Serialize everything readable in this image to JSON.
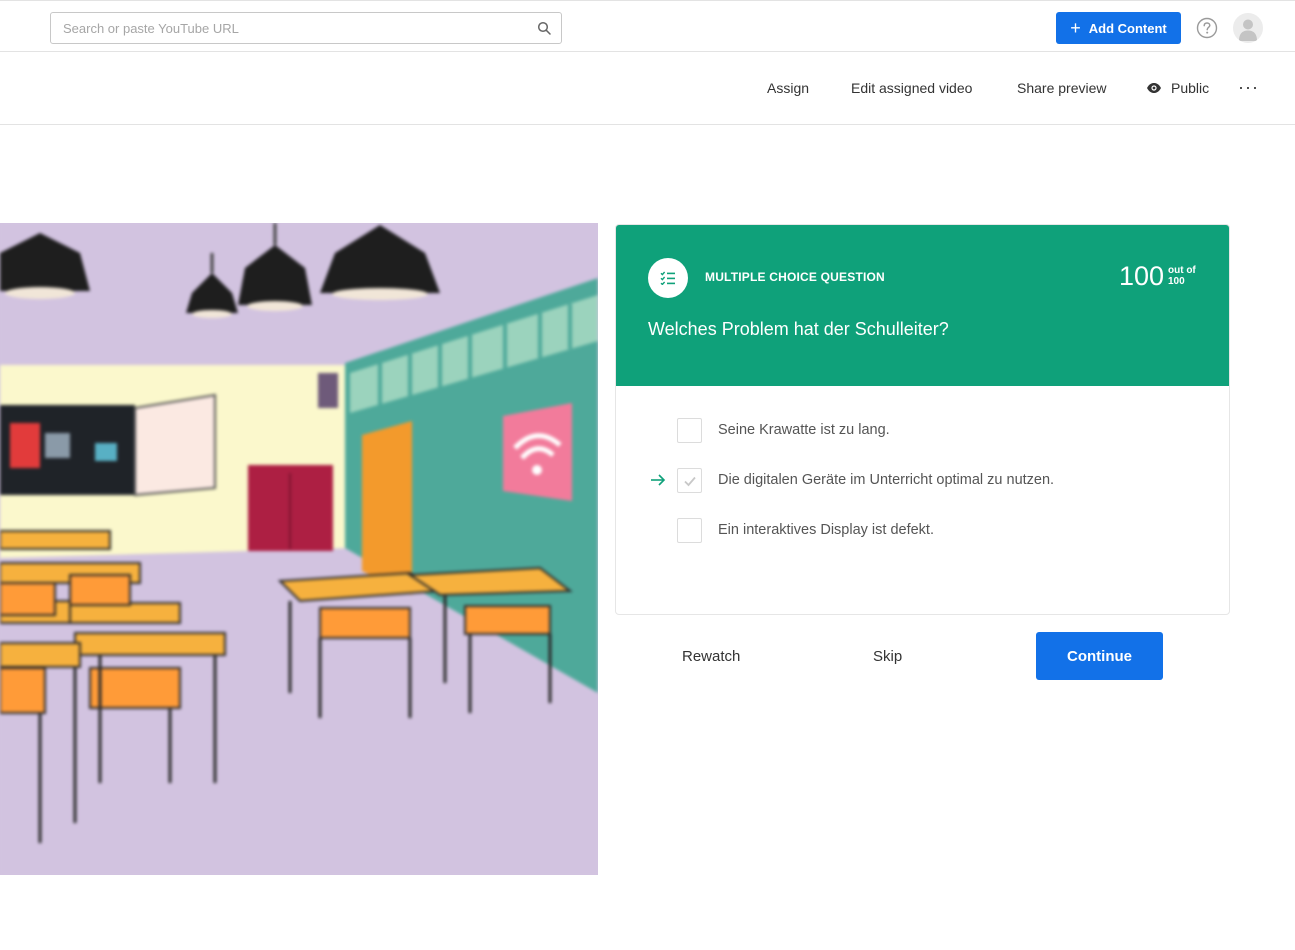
{
  "search": {
    "placeholder": "Search or paste YouTube URL",
    "value": ""
  },
  "header": {
    "add_content_label": "Add Content"
  },
  "toolbar": {
    "assign": "Assign",
    "edit_assigned_video": "Edit assigned video",
    "share_preview": "Share preview",
    "public": "Public",
    "more": "···"
  },
  "question": {
    "type": "MULTIPLE CHOICE QUESTION",
    "score": "100",
    "score_of_label": "out of",
    "score_total": "100",
    "text": "Welches Problem hat der Schulleiter?",
    "options": [
      {
        "label": "Seine Krawatte ist zu lang.",
        "checked": false,
        "correct": false
      },
      {
        "label": "Die digitalen Geräte im Unterricht optimal zu nutzen.",
        "checked": true,
        "correct": true
      },
      {
        "label": "Ein interaktives Display ist defekt.",
        "checked": false,
        "correct": false
      }
    ]
  },
  "actions": {
    "rewatch": "Rewatch",
    "skip": "Skip",
    "continue": "Continue"
  },
  "colors": {
    "accent": "#1271e8",
    "question_header": "#0fa17a",
    "video_background": "#d2c3e0"
  },
  "icons": [
    "search-icon",
    "plus-icon",
    "help-icon",
    "avatar-icon",
    "eye-icon",
    "more-icon",
    "checklist-icon",
    "arrow-right-icon",
    "check-icon"
  ]
}
